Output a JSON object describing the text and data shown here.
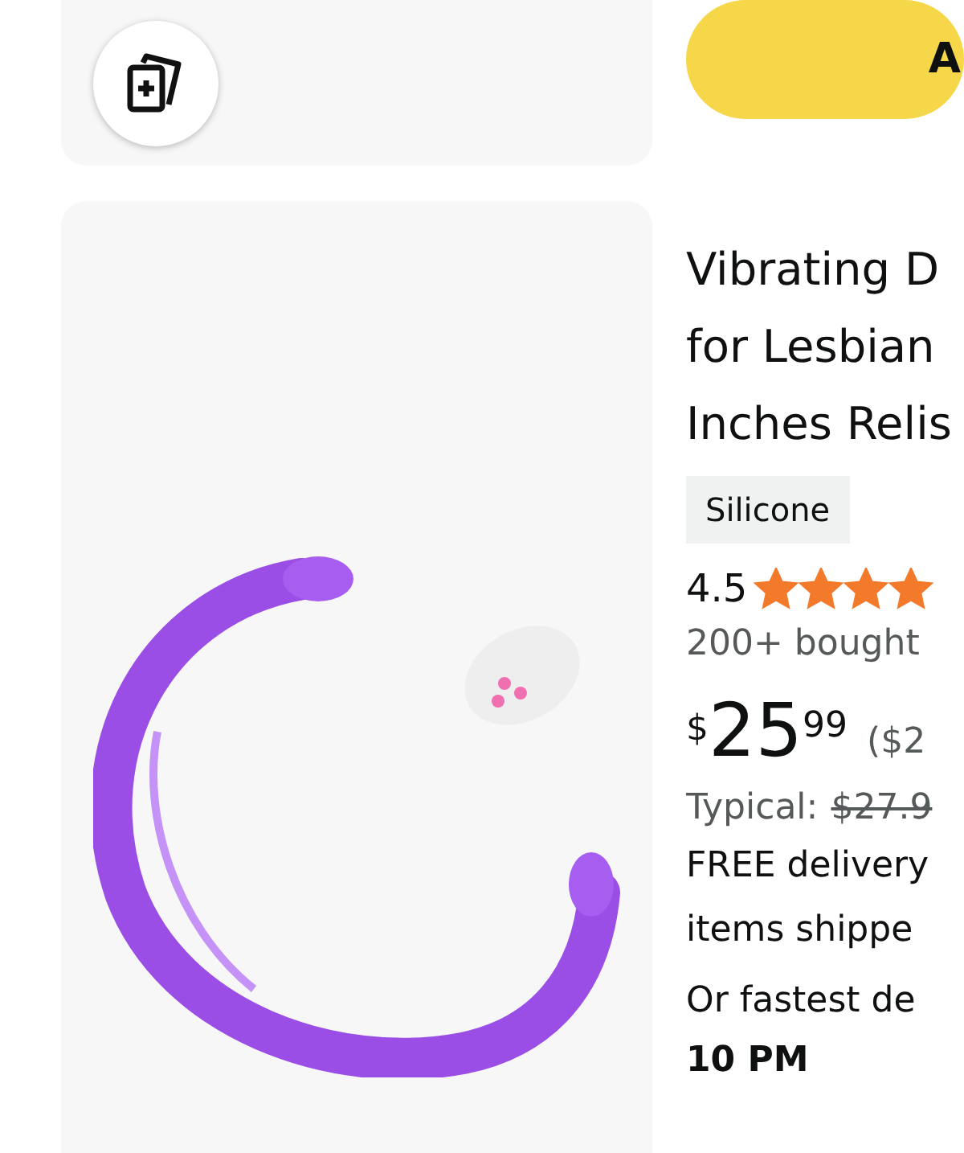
{
  "top_button": {
    "label": "A"
  },
  "product": {
    "title_lines": [
      "Vibrating D",
      "for Lesbian",
      "Inches Relis"
    ],
    "tag": "Silicone",
    "rating": "4.5",
    "stars": 4,
    "bought": "200+ bought",
    "price": {
      "currency": "$",
      "whole": "25",
      "fraction": "99",
      "unit_price": "($2"
    },
    "typical": {
      "label": "Typical:",
      "price": "$27.9"
    },
    "delivery_lines": [
      "FREE delivery",
      "items shippe"
    ],
    "fastest": "Or fastest de",
    "fastest_time": "10 PM"
  }
}
